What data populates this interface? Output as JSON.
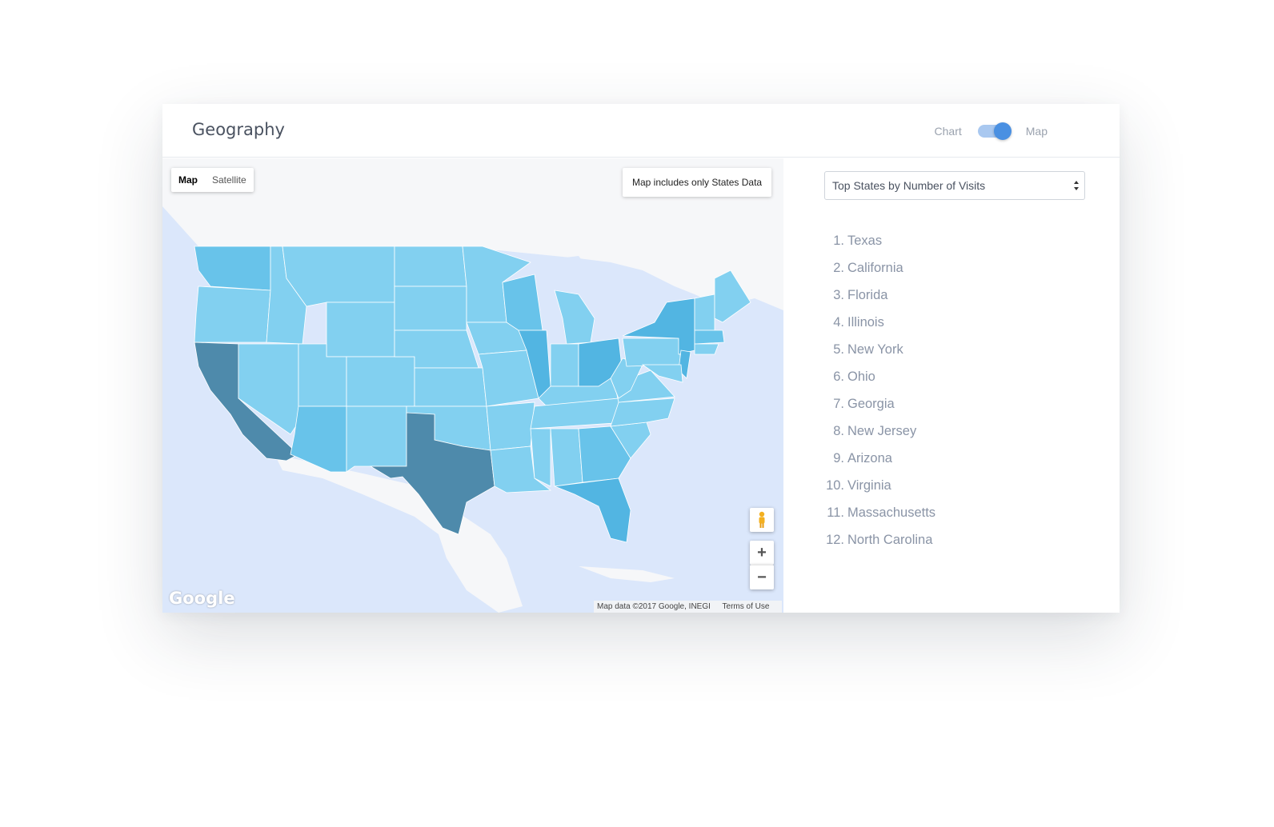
{
  "header": {
    "title": "Geography",
    "toggle_left": "Chart",
    "toggle_right": "Map",
    "toggle_active": "Map"
  },
  "map": {
    "type_buttons": [
      "Map",
      "Satellite"
    ],
    "active_type": "Map",
    "note": "Map includes only States Data",
    "zoom_in": "+",
    "zoom_out": "−",
    "logo": "Google",
    "attribution": "Map data ©2017 Google, INEGI",
    "terms": "Terms of Use",
    "colors": {
      "water": "#dbe7fb",
      "land": "#f6f7f9",
      "tier_top": "#4e8aab",
      "tier_high": "#52b5e2",
      "tier_mid": "#68c3ea",
      "tier_low": "#82d0f0"
    }
  },
  "sidebar": {
    "select_label": "Top States by Number of Visits",
    "items": [
      {
        "rank": "1.",
        "name": "Texas"
      },
      {
        "rank": "2.",
        "name": "California"
      },
      {
        "rank": "3.",
        "name": "Florida"
      },
      {
        "rank": "4.",
        "name": "Illinois"
      },
      {
        "rank": "5.",
        "name": "New York"
      },
      {
        "rank": "6.",
        "name": "Ohio"
      },
      {
        "rank": "7.",
        "name": "Georgia"
      },
      {
        "rank": "8.",
        "name": "New Jersey"
      },
      {
        "rank": "9.",
        "name": "Arizona"
      },
      {
        "rank": "10.",
        "name": "Virginia"
      },
      {
        "rank": "11.",
        "name": "Massachusetts"
      },
      {
        "rank": "12.",
        "name": "North Carolina"
      }
    ]
  }
}
